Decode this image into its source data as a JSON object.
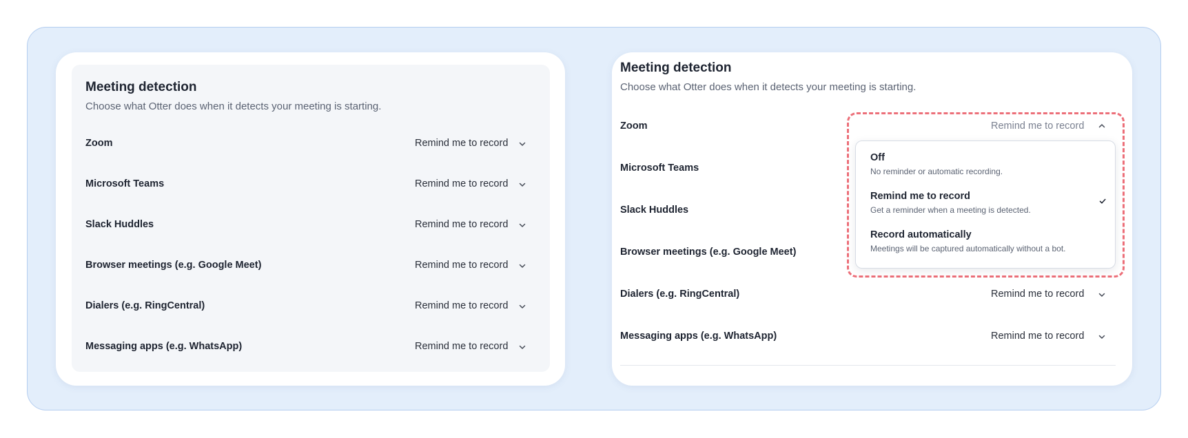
{
  "left_panel": {
    "title": "Meeting detection",
    "subtitle": "Choose what Otter does when it detects your meeting is starting.",
    "rows": [
      {
        "label": "Zoom",
        "value": "Remind me to record"
      },
      {
        "label": "Microsoft Teams",
        "value": "Remind me to record"
      },
      {
        "label": "Slack Huddles",
        "value": "Remind me to record"
      },
      {
        "label": "Browser meetings (e.g. Google Meet)",
        "value": "Remind me to record"
      },
      {
        "label": "Dialers (e.g. RingCentral)",
        "value": "Remind me to record"
      },
      {
        "label": "Messaging apps (e.g. WhatsApp)",
        "value": "Remind me to record"
      }
    ]
  },
  "right_panel": {
    "title": "Meeting detection",
    "subtitle": "Choose what Otter does when it detects your meeting is starting.",
    "rows": [
      {
        "label": "Zoom",
        "value": "Remind me to record",
        "expanded": true
      },
      {
        "label": "Microsoft Teams"
      },
      {
        "label": "Slack Huddles"
      },
      {
        "label": "Browser meetings (e.g. Google Meet)"
      },
      {
        "label": "Dialers (e.g. RingCentral)",
        "value": "Remind me to record"
      },
      {
        "label": "Messaging apps (e.g. WhatsApp)",
        "value": "Remind me to record"
      }
    ],
    "dropdown": {
      "options": [
        {
          "title": "Off",
          "description": "No reminder or automatic recording."
        },
        {
          "title": "Remind me to record",
          "description": "Get a reminder when a meeting is detected.",
          "selected": true
        },
        {
          "title": "Record automatically",
          "description": "Meetings will be captured automatically without a bot."
        }
      ]
    }
  },
  "icons": {
    "dropdown_closed": "chevron-down-icon",
    "dropdown_open": "chevron-up-icon",
    "selected": "checkmark-icon"
  },
  "colors": {
    "frame_bg": "#e3eefb",
    "highlight_dashed": "#ec6f79"
  }
}
